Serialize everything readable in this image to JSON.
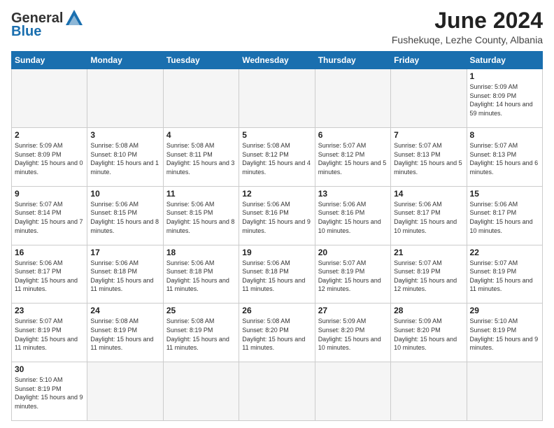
{
  "header": {
    "logo_line1": "General",
    "logo_line2": "Blue",
    "month_title": "June 2024",
    "location": "Fushekuqe, Lezhe County, Albania"
  },
  "weekdays": [
    "Sunday",
    "Monday",
    "Tuesday",
    "Wednesday",
    "Thursday",
    "Friday",
    "Saturday"
  ],
  "weeks": [
    [
      {
        "day": "",
        "info": ""
      },
      {
        "day": "",
        "info": ""
      },
      {
        "day": "",
        "info": ""
      },
      {
        "day": "",
        "info": ""
      },
      {
        "day": "",
        "info": ""
      },
      {
        "day": "",
        "info": ""
      },
      {
        "day": "1",
        "info": "Sunrise: 5:09 AM\nSunset: 8:09 PM\nDaylight: 14 hours\nand 59 minutes."
      }
    ],
    [
      {
        "day": "2",
        "info": "Sunrise: 5:09 AM\nSunset: 8:09 PM\nDaylight: 15 hours\nand 0 minutes."
      },
      {
        "day": "3",
        "info": "Sunrise: 5:08 AM\nSunset: 8:10 PM\nDaylight: 15 hours\nand 1 minute."
      },
      {
        "day": "4",
        "info": "Sunrise: 5:08 AM\nSunset: 8:11 PM\nDaylight: 15 hours\nand 3 minutes."
      },
      {
        "day": "5",
        "info": "Sunrise: 5:08 AM\nSunset: 8:12 PM\nDaylight: 15 hours\nand 4 minutes."
      },
      {
        "day": "6",
        "info": "Sunrise: 5:07 AM\nSunset: 8:12 PM\nDaylight: 15 hours\nand 5 minutes."
      },
      {
        "day": "7",
        "info": "Sunrise: 5:07 AM\nSunset: 8:13 PM\nDaylight: 15 hours\nand 5 minutes."
      },
      {
        "day": "8",
        "info": "Sunrise: 5:07 AM\nSunset: 8:13 PM\nDaylight: 15 hours\nand 6 minutes."
      }
    ],
    [
      {
        "day": "9",
        "info": "Sunrise: 5:07 AM\nSunset: 8:14 PM\nDaylight: 15 hours\nand 7 minutes."
      },
      {
        "day": "10",
        "info": "Sunrise: 5:06 AM\nSunset: 8:15 PM\nDaylight: 15 hours\nand 8 minutes."
      },
      {
        "day": "11",
        "info": "Sunrise: 5:06 AM\nSunset: 8:15 PM\nDaylight: 15 hours\nand 8 minutes."
      },
      {
        "day": "12",
        "info": "Sunrise: 5:06 AM\nSunset: 8:16 PM\nDaylight: 15 hours\nand 9 minutes."
      },
      {
        "day": "13",
        "info": "Sunrise: 5:06 AM\nSunset: 8:16 PM\nDaylight: 15 hours\nand 10 minutes."
      },
      {
        "day": "14",
        "info": "Sunrise: 5:06 AM\nSunset: 8:17 PM\nDaylight: 15 hours\nand 10 minutes."
      },
      {
        "day": "15",
        "info": "Sunrise: 5:06 AM\nSunset: 8:17 PM\nDaylight: 15 hours\nand 10 minutes."
      }
    ],
    [
      {
        "day": "16",
        "info": "Sunrise: 5:06 AM\nSunset: 8:17 PM\nDaylight: 15 hours\nand 11 minutes."
      },
      {
        "day": "17",
        "info": "Sunrise: 5:06 AM\nSunset: 8:18 PM\nDaylight: 15 hours\nand 11 minutes."
      },
      {
        "day": "18",
        "info": "Sunrise: 5:06 AM\nSunset: 8:18 PM\nDaylight: 15 hours\nand 11 minutes."
      },
      {
        "day": "19",
        "info": "Sunrise: 5:06 AM\nSunset: 8:18 PM\nDaylight: 15 hours\nand 11 minutes."
      },
      {
        "day": "20",
        "info": "Sunrise: 5:07 AM\nSunset: 8:19 PM\nDaylight: 15 hours\nand 12 minutes."
      },
      {
        "day": "21",
        "info": "Sunrise: 5:07 AM\nSunset: 8:19 PM\nDaylight: 15 hours\nand 12 minutes."
      },
      {
        "day": "22",
        "info": "Sunrise: 5:07 AM\nSunset: 8:19 PM\nDaylight: 15 hours\nand 11 minutes."
      }
    ],
    [
      {
        "day": "23",
        "info": "Sunrise: 5:07 AM\nSunset: 8:19 PM\nDaylight: 15 hours\nand 11 minutes."
      },
      {
        "day": "24",
        "info": "Sunrise: 5:08 AM\nSunset: 8:19 PM\nDaylight: 15 hours\nand 11 minutes."
      },
      {
        "day": "25",
        "info": "Sunrise: 5:08 AM\nSunset: 8:19 PM\nDaylight: 15 hours\nand 11 minutes."
      },
      {
        "day": "26",
        "info": "Sunrise: 5:08 AM\nSunset: 8:20 PM\nDaylight: 15 hours\nand 11 minutes."
      },
      {
        "day": "27",
        "info": "Sunrise: 5:09 AM\nSunset: 8:20 PM\nDaylight: 15 hours\nand 10 minutes."
      },
      {
        "day": "28",
        "info": "Sunrise: 5:09 AM\nSunset: 8:20 PM\nDaylight: 15 hours\nand 10 minutes."
      },
      {
        "day": "29",
        "info": "Sunrise: 5:10 AM\nSunset: 8:19 PM\nDaylight: 15 hours\nand 9 minutes."
      }
    ],
    [
      {
        "day": "30",
        "info": "Sunrise: 5:10 AM\nSunset: 8:19 PM\nDaylight: 15 hours\nand 9 minutes."
      },
      {
        "day": "",
        "info": ""
      },
      {
        "day": "",
        "info": ""
      },
      {
        "day": "",
        "info": ""
      },
      {
        "day": "",
        "info": ""
      },
      {
        "day": "",
        "info": ""
      },
      {
        "day": "",
        "info": ""
      }
    ]
  ]
}
